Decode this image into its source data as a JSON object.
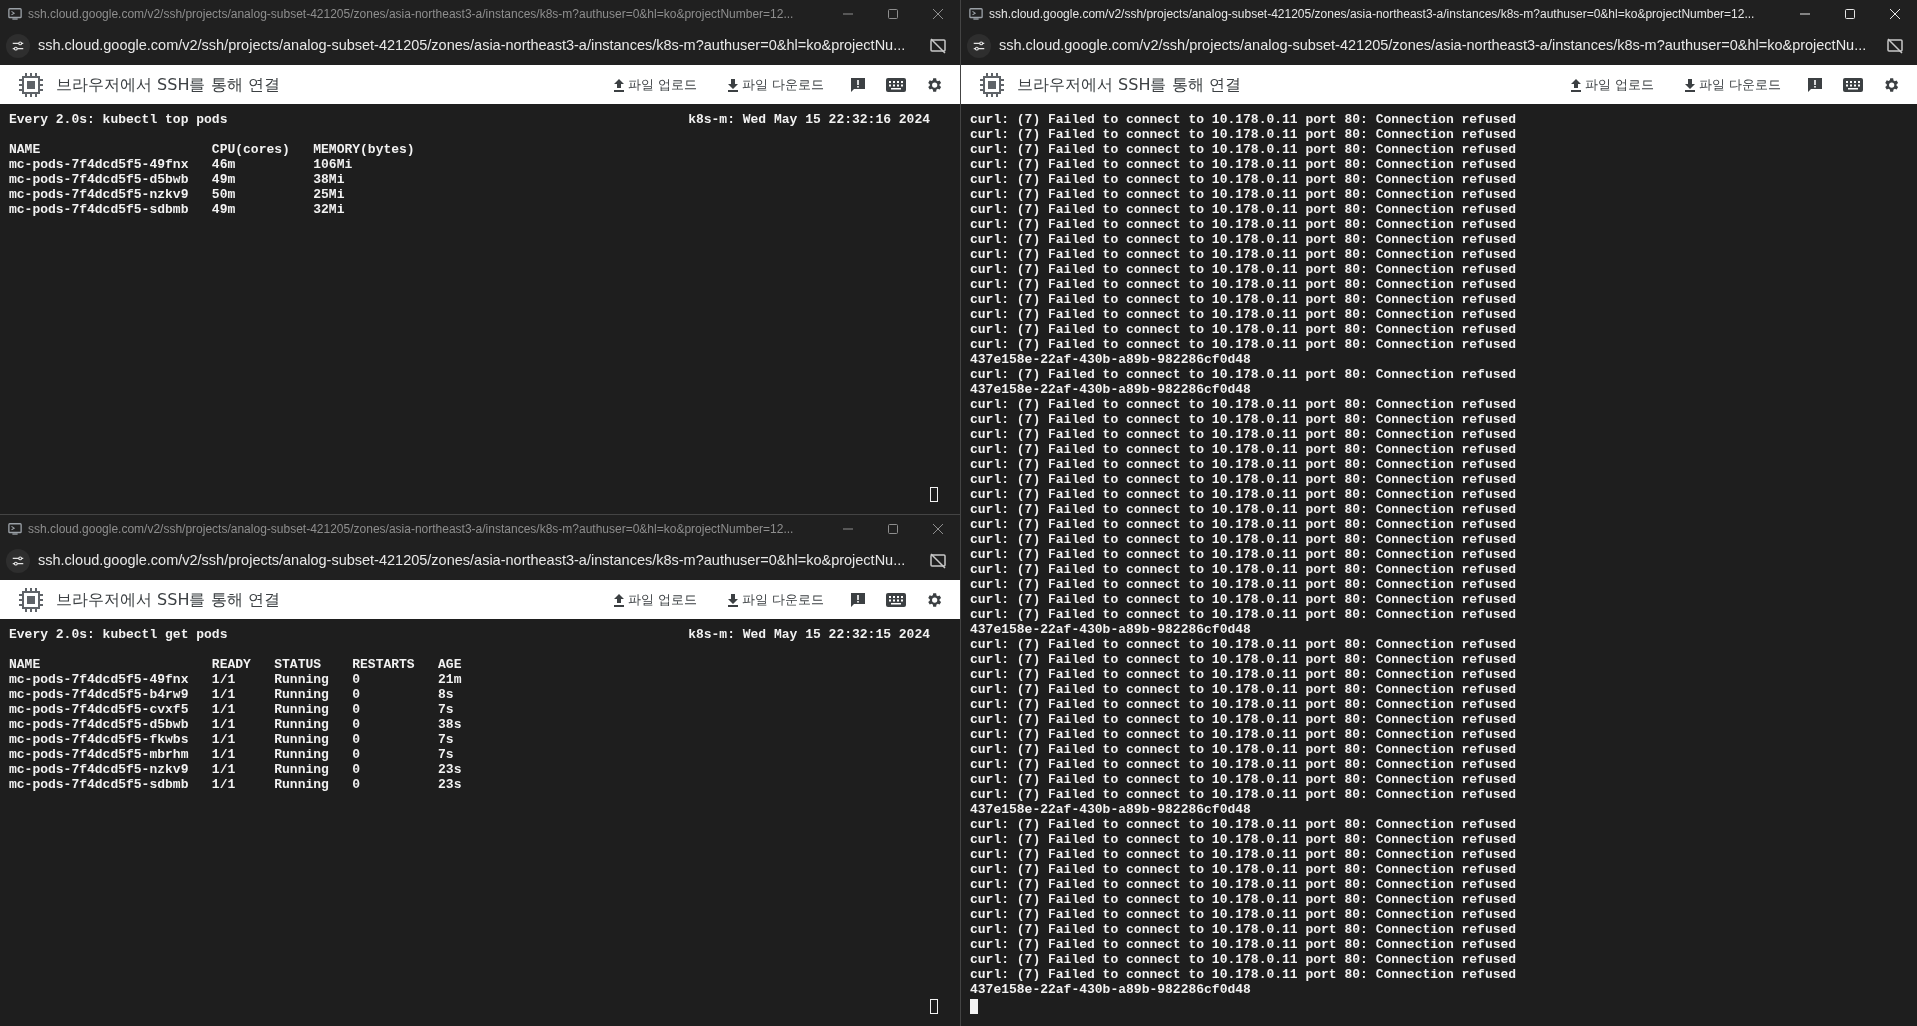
{
  "windows": [
    {
      "title": "ssh.cloud.google.com/v2/ssh/projects/analog-subset-421205/zones/asia-northeast3-a/instances/k8s-m?authuser=0&hl=ko&projectNumber=12...",
      "active": false,
      "url": "ssh.cloud.google.com/v2/ssh/projects/analog-subset-421205/zones/asia-northeast3-a/instances/k8s-m?authuser=0&hl=ko&projectNu...",
      "header_title": "브라우저에서 SSH를 통해 연결",
      "upload": "파일 업로드",
      "download": "파일 다운로드",
      "terminal": {
        "kind": "watch",
        "command": "Every 2.0s: kubectl top pods",
        "host_time": "k8s-m: Wed May 15 22:32:16 2024",
        "focused": false,
        "columns": [
          "NAME",
          "CPU(cores)",
          "MEMORY(bytes)"
        ],
        "rows": [
          [
            "mc-pods-7f4dcd5f5-49fnx",
            "46m",
            "106Mi"
          ],
          [
            "mc-pods-7f4dcd5f5-d5bwb",
            "49m",
            "38Mi"
          ],
          [
            "mc-pods-7f4dcd5f5-nzkv9",
            "50m",
            "25Mi"
          ],
          [
            "mc-pods-7f4dcd5f5-sdbmb",
            "49m",
            "32Mi"
          ]
        ]
      }
    },
    {
      "title": "ssh.cloud.google.com/v2/ssh/projects/analog-subset-421205/zones/asia-northeast3-a/instances/k8s-m?authuser=0&hl=ko&projectNumber=12...",
      "active": false,
      "url": "ssh.cloud.google.com/v2/ssh/projects/analog-subset-421205/zones/asia-northeast3-a/instances/k8s-m?authuser=0&hl=ko&projectNu...",
      "header_title": "브라우저에서 SSH를 통해 연결",
      "upload": "파일 업로드",
      "download": "파일 다운로드",
      "terminal": {
        "kind": "watch",
        "command": "Every 2.0s: kubectl get pods",
        "host_time": "k8s-m: Wed May 15 22:32:15 2024",
        "focused": false,
        "columns": [
          "NAME",
          "READY",
          "STATUS",
          "RESTARTS",
          "AGE"
        ],
        "rows": [
          [
            "mc-pods-7f4dcd5f5-49fnx",
            "1/1",
            "Running",
            "0",
            "21m"
          ],
          [
            "mc-pods-7f4dcd5f5-b4rw9",
            "1/1",
            "Running",
            "0",
            "8s"
          ],
          [
            "mc-pods-7f4dcd5f5-cvxf5",
            "1/1",
            "Running",
            "0",
            "7s"
          ],
          [
            "mc-pods-7f4dcd5f5-d5bwb",
            "1/1",
            "Running",
            "0",
            "38s"
          ],
          [
            "mc-pods-7f4dcd5f5-fkwbs",
            "1/1",
            "Running",
            "0",
            "7s"
          ],
          [
            "mc-pods-7f4dcd5f5-mbrhm",
            "1/1",
            "Running",
            "0",
            "7s"
          ],
          [
            "mc-pods-7f4dcd5f5-nzkv9",
            "1/1",
            "Running",
            "0",
            "23s"
          ],
          [
            "mc-pods-7f4dcd5f5-sdbmb",
            "1/1",
            "Running",
            "0",
            "23s"
          ]
        ]
      }
    },
    {
      "title": "ssh.cloud.google.com/v2/ssh/projects/analog-subset-421205/zones/asia-northeast3-a/instances/k8s-m?authuser=0&hl=ko&projectNumber=12...",
      "active": true,
      "url": "ssh.cloud.google.com/v2/ssh/projects/analog-subset-421205/zones/asia-northeast3-a/instances/k8s-m?authuser=0&hl=ko&projectNu...",
      "header_title": "브라우저에서 SSH를 통해 연결",
      "upload": "파일 업로드",
      "download": "파일 다운로드",
      "terminal": {
        "kind": "log",
        "focused": true,
        "lines": [
          "curl: (7) Failed to connect to 10.178.0.11 port 80: Connection refused",
          "curl: (7) Failed to connect to 10.178.0.11 port 80: Connection refused",
          "curl: (7) Failed to connect to 10.178.0.11 port 80: Connection refused",
          "curl: (7) Failed to connect to 10.178.0.11 port 80: Connection refused",
          "curl: (7) Failed to connect to 10.178.0.11 port 80: Connection refused",
          "curl: (7) Failed to connect to 10.178.0.11 port 80: Connection refused",
          "curl: (7) Failed to connect to 10.178.0.11 port 80: Connection refused",
          "curl: (7) Failed to connect to 10.178.0.11 port 80: Connection refused",
          "curl: (7) Failed to connect to 10.178.0.11 port 80: Connection refused",
          "curl: (7) Failed to connect to 10.178.0.11 port 80: Connection refused",
          "curl: (7) Failed to connect to 10.178.0.11 port 80: Connection refused",
          "curl: (7) Failed to connect to 10.178.0.11 port 80: Connection refused",
          "curl: (7) Failed to connect to 10.178.0.11 port 80: Connection refused",
          "curl: (7) Failed to connect to 10.178.0.11 port 80: Connection refused",
          "curl: (7) Failed to connect to 10.178.0.11 port 80: Connection refused",
          "curl: (7) Failed to connect to 10.178.0.11 port 80: Connection refused",
          "437e158e-22af-430b-a89b-982286cf0d48",
          "curl: (7) Failed to connect to 10.178.0.11 port 80: Connection refused",
          "437e158e-22af-430b-a89b-982286cf0d48",
          "curl: (7) Failed to connect to 10.178.0.11 port 80: Connection refused",
          "curl: (7) Failed to connect to 10.178.0.11 port 80: Connection refused",
          "curl: (7) Failed to connect to 10.178.0.11 port 80: Connection refused",
          "curl: (7) Failed to connect to 10.178.0.11 port 80: Connection refused",
          "curl: (7) Failed to connect to 10.178.0.11 port 80: Connection refused",
          "curl: (7) Failed to connect to 10.178.0.11 port 80: Connection refused",
          "curl: (7) Failed to connect to 10.178.0.11 port 80: Connection refused",
          "curl: (7) Failed to connect to 10.178.0.11 port 80: Connection refused",
          "curl: (7) Failed to connect to 10.178.0.11 port 80: Connection refused",
          "curl: (7) Failed to connect to 10.178.0.11 port 80: Connection refused",
          "curl: (7) Failed to connect to 10.178.0.11 port 80: Connection refused",
          "curl: (7) Failed to connect to 10.178.0.11 port 80: Connection refused",
          "curl: (7) Failed to connect to 10.178.0.11 port 80: Connection refused",
          "curl: (7) Failed to connect to 10.178.0.11 port 80: Connection refused",
          "curl: (7) Failed to connect to 10.178.0.11 port 80: Connection refused",
          "437e158e-22af-430b-a89b-982286cf0d48",
          "curl: (7) Failed to connect to 10.178.0.11 port 80: Connection refused",
          "curl: (7) Failed to connect to 10.178.0.11 port 80: Connection refused",
          "curl: (7) Failed to connect to 10.178.0.11 port 80: Connection refused",
          "curl: (7) Failed to connect to 10.178.0.11 port 80: Connection refused",
          "curl: (7) Failed to connect to 10.178.0.11 port 80: Connection refused",
          "curl: (7) Failed to connect to 10.178.0.11 port 80: Connection refused",
          "curl: (7) Failed to connect to 10.178.0.11 port 80: Connection refused",
          "curl: (7) Failed to connect to 10.178.0.11 port 80: Connection refused",
          "curl: (7) Failed to connect to 10.178.0.11 port 80: Connection refused",
          "curl: (7) Failed to connect to 10.178.0.11 port 80: Connection refused",
          "curl: (7) Failed to connect to 10.178.0.11 port 80: Connection refused",
          "437e158e-22af-430b-a89b-982286cf0d48",
          "curl: (7) Failed to connect to 10.178.0.11 port 80: Connection refused",
          "curl: (7) Failed to connect to 10.178.0.11 port 80: Connection refused",
          "curl: (7) Failed to connect to 10.178.0.11 port 80: Connection refused",
          "curl: (7) Failed to connect to 10.178.0.11 port 80: Connection refused",
          "curl: (7) Failed to connect to 10.178.0.11 port 80: Connection refused",
          "curl: (7) Failed to connect to 10.178.0.11 port 80: Connection refused",
          "curl: (7) Failed to connect to 10.178.0.11 port 80: Connection refused",
          "curl: (7) Failed to connect to 10.178.0.11 port 80: Connection refused",
          "curl: (7) Failed to connect to 10.178.0.11 port 80: Connection refused",
          "curl: (7) Failed to connect to 10.178.0.11 port 80: Connection refused",
          "curl: (7) Failed to connect to 10.178.0.11 port 80: Connection refused",
          "437e158e-22af-430b-a89b-982286cf0d48"
        ]
      }
    }
  ]
}
